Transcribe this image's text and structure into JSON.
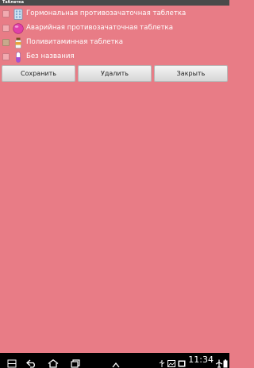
{
  "window": {
    "title": "Таблетка"
  },
  "items": [
    {
      "label": "Гормональная противозачаточная таблетка",
      "icon": "blister-pack-icon",
      "checked": false
    },
    {
      "label": "Аварийная противозачаточная таблетка",
      "icon": "pink-pill-icon",
      "checked": false
    },
    {
      "label": "Поливитаминная таблетка",
      "icon": "vitamin-bottle-icon",
      "checked": false
    },
    {
      "label": "Без названия",
      "icon": "capsule-icon",
      "checked": false
    }
  ],
  "buttons": {
    "save": "Сохранить",
    "delete": "Удалить",
    "close": "Закрыть"
  },
  "statusbar": {
    "time": "11:34"
  },
  "colors": {
    "background": "#e87c86",
    "navbar": "#000000"
  }
}
